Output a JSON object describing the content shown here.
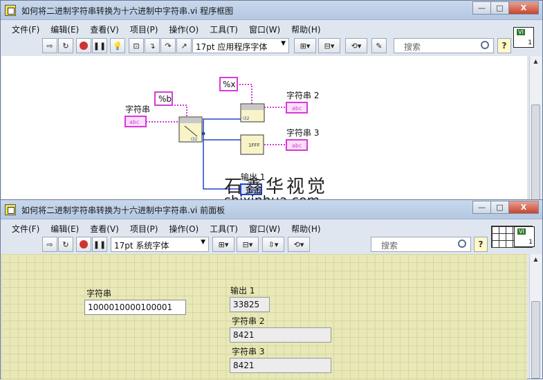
{
  "block_diagram": {
    "title": "如何将二进制字符串转换为十六进制中字符串.vi 程序框图",
    "menu": [
      "文件(F)",
      "编辑(E)",
      "查看(V)",
      "项目(P)",
      "操作(O)",
      "工具(T)",
      "窗口(W)",
      "帮助(H)"
    ],
    "font_select": "17pt 应用程序字体",
    "search_placeholder": "搜索",
    "nodes": {
      "input_label": "字符串",
      "input_terminal": "abc",
      "format_b": "%b",
      "format_x": "%x",
      "out2_label": "字符串 2",
      "out3_label": "字符串 3",
      "out1_label": "输出 1",
      "terminal_text": "abc",
      "i32": "I32",
      "hex_text": "1FFF"
    }
  },
  "front_panel": {
    "title": "如何将二进制字符串转换为十六进制中字符串.vi 前面板",
    "menu": [
      "文件(F)",
      "编辑(E)",
      "查看(V)",
      "项目(P)",
      "操作(O)",
      "工具(T)",
      "窗口(W)",
      "帮助(H)"
    ],
    "font_select": "17pt 系统字体",
    "search_placeholder": "搜索",
    "controls": {
      "string_label": "字符串",
      "string_value": "1000010000100001",
      "output1_label": "输出 1",
      "output1_value": "33825",
      "string2_label": "字符串 2",
      "string2_value": "8421",
      "string3_label": "字符串 3",
      "string3_value": "8421"
    }
  },
  "watermark": {
    "site": "shixinhua.com",
    "calligraphy": "石鑫华视觉"
  },
  "window_buttons": {
    "minimize": "—",
    "maximize": "□",
    "close": "X"
  },
  "icon_labels": {
    "vi_tag": "VI",
    "vi_num": "1",
    "help": "?"
  },
  "colors": {
    "string_wire": "#d63ad6",
    "int_wire": "#2244cc",
    "fp_bg": "#e8e8b8"
  }
}
